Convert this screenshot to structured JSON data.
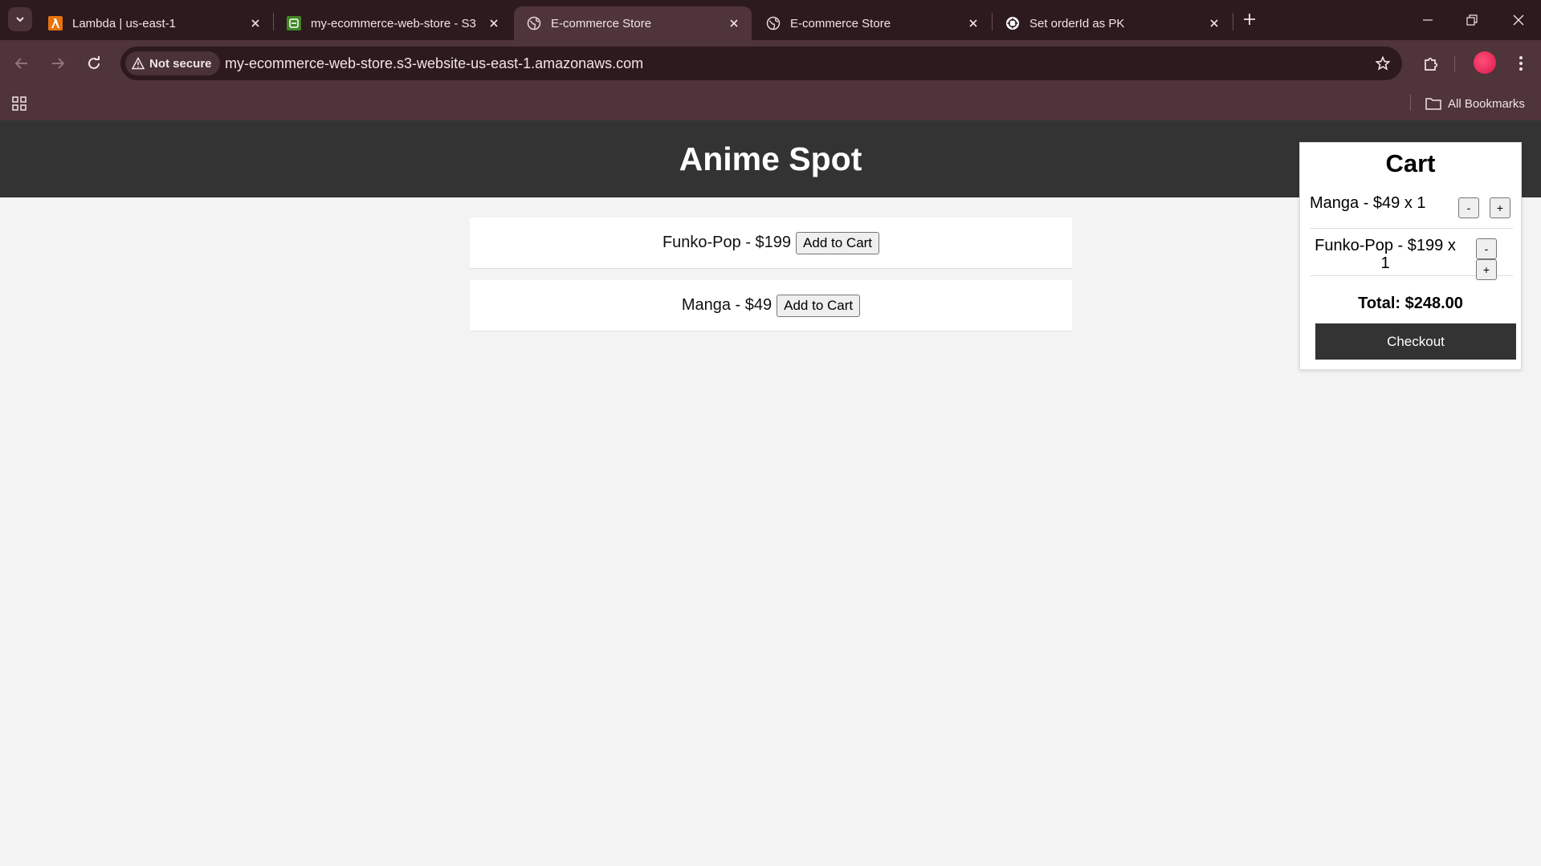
{
  "browser": {
    "tabs": [
      {
        "title": "Lambda | us-east-1",
        "icon": "aws-lambda-icon",
        "active": false
      },
      {
        "title": "my-ecommerce-web-store - S3",
        "icon": "s3-bucket-icon",
        "active": false
      },
      {
        "title": "E-commerce Store",
        "icon": "globe-icon",
        "active": true
      },
      {
        "title": "E-commerce Store",
        "icon": "globe-icon",
        "active": false
      },
      {
        "title": "Set orderId as PK",
        "icon": "chatgpt-icon",
        "active": false
      }
    ],
    "security_label": "Not secure",
    "url": "my-ecommerce-web-store.s3-website-us-east-1.amazonaws.com",
    "all_bookmarks_label": "All Bookmarks"
  },
  "store": {
    "title": "Anime Spot",
    "products": [
      {
        "label": "Funko-Pop - $199",
        "button": "Add to Cart"
      },
      {
        "label": "Manga - $49",
        "button": "Add to Cart"
      }
    ],
    "cart": {
      "title": "Cart",
      "items": [
        {
          "label": "Manga - $49 x 1",
          "minus": "-",
          "plus": "+"
        },
        {
          "label_line1": "Funko-Pop - $199 x",
          "label_line2": "1",
          "minus": "-",
          "plus": "+"
        }
      ],
      "total": "Total: $248.00",
      "checkout": "Checkout"
    }
  },
  "colors": {
    "tabstrip": "#2c1a1f",
    "toolbar": "#4f3439",
    "site_header": "#333333",
    "page_background": "#f3f3f3"
  }
}
